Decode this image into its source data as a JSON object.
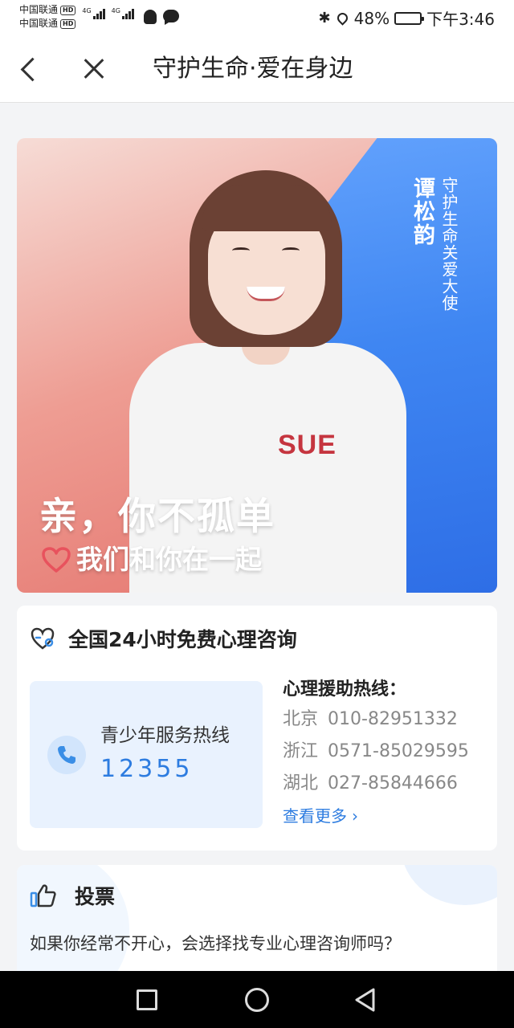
{
  "status_bar": {
    "carrier_1": "中国联通",
    "carrier_2": "中国联通",
    "hd_label": "HD",
    "net_label": "4G",
    "battery_percent": "48%",
    "battery_level": 0.48,
    "time": "下午3:46",
    "icons": [
      "bluetooth-icon",
      "location-icon",
      "battery-icon",
      "qq-icon",
      "message-icon"
    ]
  },
  "nav": {
    "title": "守护生命·爱在身边"
  },
  "banner": {
    "vertical_main": "谭松韵",
    "vertical_sub": "守护生命关爱大使",
    "shirt_text": "SUE",
    "slogan": "亲，你不孤单",
    "sub_slogan": "我们和你在一起"
  },
  "hotline": {
    "title": "全国24小时免费心理咨询",
    "youth_label": "青少年服务热线",
    "youth_number": "12355",
    "assist_title": "心理援助热线：",
    "lines": [
      {
        "region": "北京",
        "number": "010-82951332"
      },
      {
        "region": "浙江",
        "number": "0571-85029595"
      },
      {
        "region": "湖北",
        "number": "027-85844666"
      }
    ],
    "more": "查看更多",
    "more_arrow": "›"
  },
  "vote": {
    "title": "投票",
    "question": "如果你经常不开心，会选择找专业心理咨询师吗？"
  },
  "colors": {
    "accent_blue": "#2d7ce0",
    "banner_blue": "#3f86f2",
    "banner_red": "#e36e68",
    "heart": "#e8525d"
  }
}
